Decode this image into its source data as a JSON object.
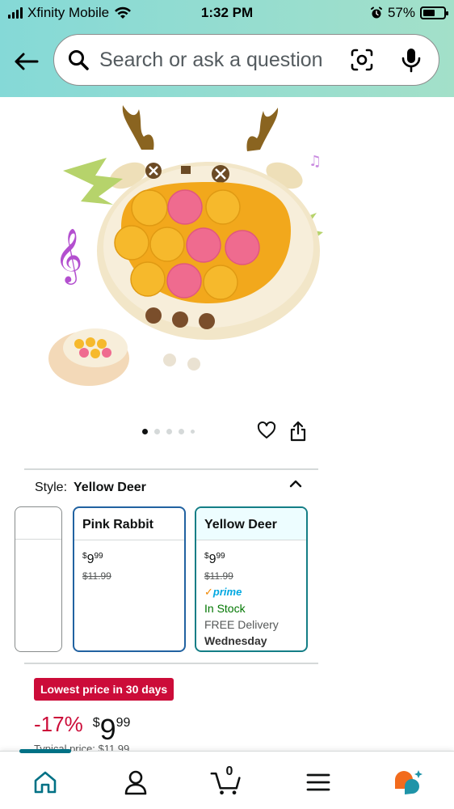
{
  "status_bar": {
    "carrier": "Xfinity Mobile",
    "time": "1:32 PM",
    "battery": "57%",
    "battery_level": 0.57
  },
  "header": {
    "back_icon": "arrow-left-icon",
    "search_placeholder": "Search or ask a question",
    "camera_icon": "camera-scan-icon",
    "mic_icon": "microphone-icon"
  },
  "gallery": {
    "image_count": 5,
    "active_index": 0
  },
  "style": {
    "label": "Style:",
    "selected": "Yellow Deer"
  },
  "options": [
    {
      "name": "Pink Rabbit",
      "price_symbol": "$",
      "price_whole": "9",
      "price_fraction": "99",
      "list_price": "$11.99"
    },
    {
      "name": "Yellow Deer",
      "price_symbol": "$",
      "price_whole": "9",
      "price_fraction": "99",
      "list_price": "$11.99",
      "prime": "prime",
      "stock": "In Stock",
      "delivery": "FREE Delivery",
      "delivery_day": "Wednesday"
    }
  ],
  "deal": {
    "badge": "Lowest price in 30 days",
    "discount": "-17%",
    "price_symbol": "$",
    "price_whole": "9",
    "price_fraction": "99",
    "typical_price": "Typical price: $11.99"
  },
  "bottom_nav": {
    "cart_count": "0",
    "items": [
      "home-icon",
      "account-icon",
      "cart-icon",
      "menu-icon",
      "rufus-ai-icon"
    ]
  },
  "colors": {
    "header_gradient_start": "#85d9d7",
    "header_gradient_end": "#a3e0c9",
    "selected_border": "#147e86",
    "deal_red": "#cc0c39",
    "in_stock_green": "#007600",
    "prime_blue": "#00a8e1"
  }
}
